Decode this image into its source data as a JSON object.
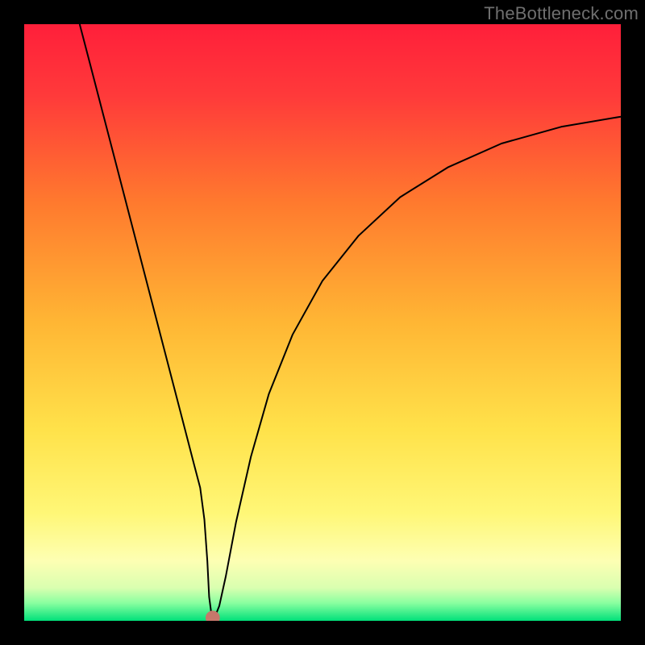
{
  "watermark": "TheBottleneck.com",
  "colors": {
    "bg_black": "#000000",
    "gradient_stops": [
      {
        "offset": 0.0,
        "color": "#ff1f3a"
      },
      {
        "offset": 0.12,
        "color": "#ff3a3a"
      },
      {
        "offset": 0.3,
        "color": "#ff7a2e"
      },
      {
        "offset": 0.5,
        "color": "#ffb634"
      },
      {
        "offset": 0.68,
        "color": "#ffe24a"
      },
      {
        "offset": 0.82,
        "color": "#fff777"
      },
      {
        "offset": 0.9,
        "color": "#fdffb3"
      },
      {
        "offset": 0.945,
        "color": "#d9ffb0"
      },
      {
        "offset": 0.97,
        "color": "#8affa0"
      },
      {
        "offset": 1.0,
        "color": "#00e07a"
      }
    ],
    "curve": "#000000",
    "marker": "#c7776b"
  },
  "chart_data": {
    "type": "line",
    "title": "",
    "xlabel": "",
    "ylabel": "",
    "xlim": [
      0,
      100
    ],
    "ylim": [
      0,
      100
    ],
    "grid": false,
    "legend": false,
    "series": [
      {
        "name": "bottleneck-curve",
        "x": [
          9.3,
          11,
          13,
          15,
          17,
          19,
          21,
          23,
          25,
          27,
          28.5,
          29.5,
          30.2,
          30.7,
          31.0,
          31.4,
          31.9,
          32.7,
          33.8,
          35.5,
          38,
          41,
          45,
          50,
          56,
          63,
          71,
          80,
          90,
          100
        ],
        "y": [
          100,
          93.5,
          85.8,
          78.1,
          70.4,
          62.7,
          55.0,
          47.3,
          39.6,
          31.9,
          26.1,
          22.3,
          17.0,
          10.0,
          4.0,
          1.0,
          0.5,
          2.5,
          7.5,
          16.5,
          27.5,
          38.0,
          48.0,
          57.0,
          64.5,
          71.0,
          76.0,
          80.0,
          82.8,
          84.5
        ]
      }
    ],
    "marker": {
      "x": 31.6,
      "y": 0.5,
      "r": 1.2
    }
  }
}
